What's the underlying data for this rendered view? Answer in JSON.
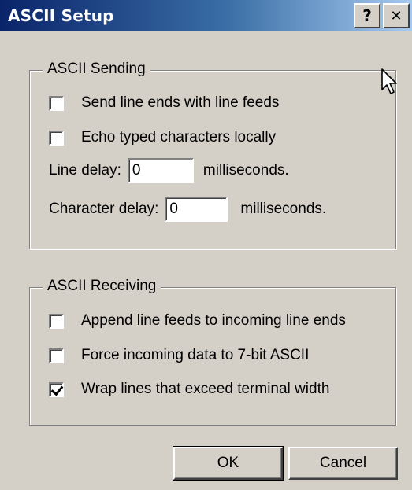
{
  "window": {
    "title": "ASCII Setup",
    "help_glyph": "?",
    "close_glyph": "✕"
  },
  "sending": {
    "legend": "ASCII Sending",
    "send_line_ends": {
      "label": "Send line ends with line feeds",
      "checked": false
    },
    "echo_locally": {
      "label": "Echo typed characters locally",
      "checked": false
    },
    "line_delay": {
      "label": "Line delay:",
      "value": "0",
      "unit": "milliseconds."
    },
    "char_delay": {
      "label": "Character delay:",
      "value": "0",
      "unit": "milliseconds."
    }
  },
  "receiving": {
    "legend": "ASCII Receiving",
    "append_line_feeds": {
      "label": "Append line feeds to incoming line ends",
      "checked": false
    },
    "force_7bit": {
      "label": "Force incoming data to 7-bit ASCII",
      "checked": false
    },
    "wrap_lines": {
      "label": "Wrap lines that exceed terminal width",
      "checked": true
    }
  },
  "buttons": {
    "ok": "OK",
    "cancel": "Cancel"
  },
  "colors": {
    "title_start": "#0a246a",
    "title_end": "#a6caf0",
    "face": "#d4d0c8"
  },
  "icons": {
    "cursor": "mouse-pointer-icon"
  }
}
